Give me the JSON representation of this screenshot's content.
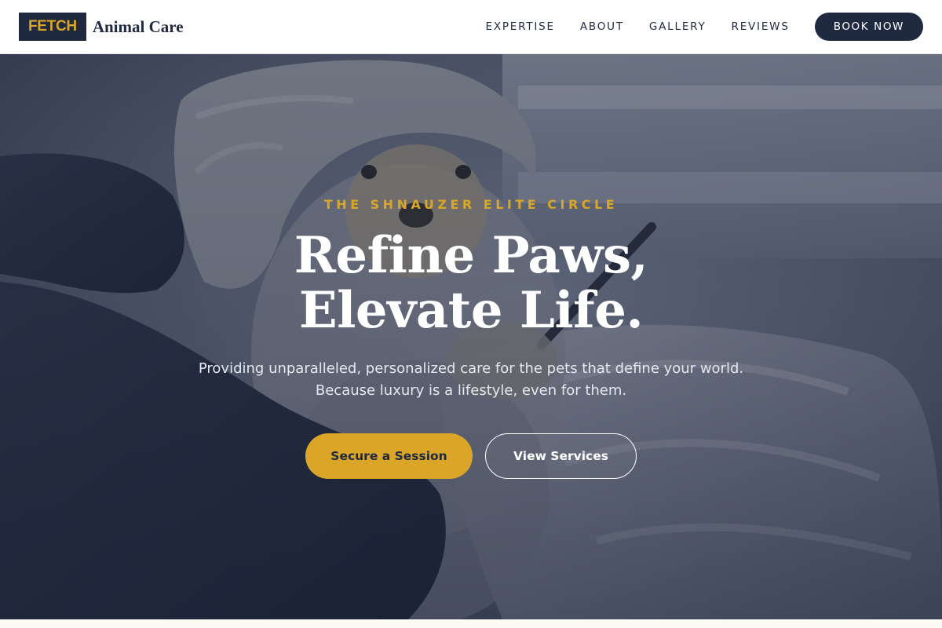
{
  "brand": {
    "badge": "FETCH",
    "name": "Animal Care"
  },
  "nav": {
    "items": [
      {
        "label": "EXPERTISE"
      },
      {
        "label": "ABOUT"
      },
      {
        "label": "GALLERY"
      },
      {
        "label": "REVIEWS"
      }
    ],
    "cta_label": "BOOK NOW"
  },
  "hero": {
    "eyebrow": "THE SHNAUZER ELITE CIRCLE",
    "headline_line1": "Refine Paws,",
    "headline_line2": "Elevate Life.",
    "subtext": "Providing unparalleled, personalized care for the pets that define your world. Because luxury is a lifestyle, even for them.",
    "primary_cta": "Secure a Session",
    "secondary_cta": "View Services"
  },
  "colors": {
    "navy": "#1f2a40",
    "gold": "#d9a628",
    "white": "#ffffff"
  }
}
